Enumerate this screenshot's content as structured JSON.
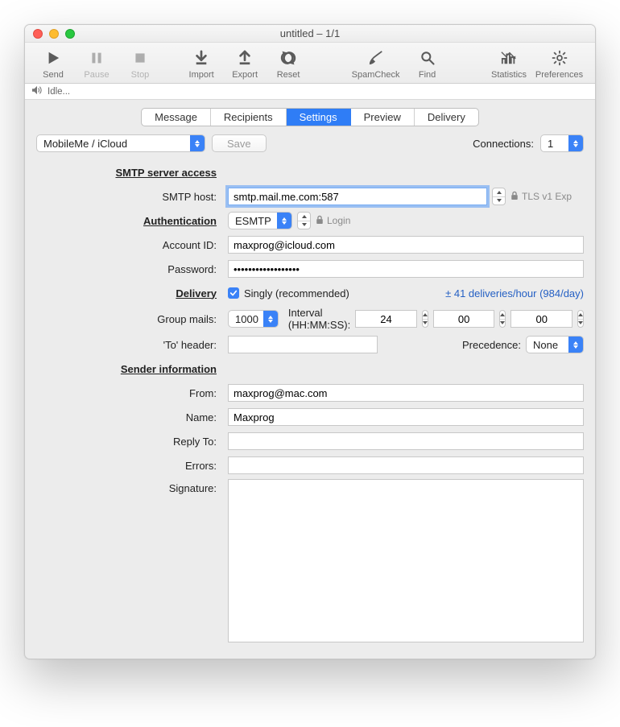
{
  "window": {
    "title": "untitled – 1/1"
  },
  "toolbar": {
    "send": "Send",
    "pause": "Pause",
    "stop": "Stop",
    "import": "Import",
    "export": "Export",
    "reset": "Reset",
    "spamcheck": "SpamCheck",
    "find": "Find",
    "statistics": "Statistics",
    "prefs": "Preferences"
  },
  "status": {
    "text": "Idle..."
  },
  "tabs": {
    "message": "Message",
    "recipients": "Recipients",
    "settings": "Settings",
    "preview": "Preview",
    "delivery": "Delivery"
  },
  "account": {
    "selected": "MobileMe / iCloud",
    "save": "Save",
    "connections_label": "Connections:",
    "connections_value": "1"
  },
  "sections": {
    "smtp": "SMTP server access",
    "auth": "Authentication",
    "delivery": "Delivery",
    "sender": "Sender information"
  },
  "labels": {
    "smtp_host": "SMTP host:",
    "account_id": "Account ID:",
    "password": "Password:",
    "group_mails": "Group mails:",
    "to_header": "'To' header:",
    "from": "From:",
    "name": "Name:",
    "reply_to": "Reply To:",
    "errors": "Errors:",
    "signature": "Signature:",
    "interval": "Interval (HH:MM:SS):",
    "precedence": "Precedence:",
    "tls": "TLS v1 Exp",
    "login": "Login",
    "singly": "Singly (recommended)",
    "rate": "± 41 deliveries/hour (984/day)"
  },
  "values": {
    "smtp_host": "smtp.mail.me.com:587",
    "auth_mode": "ESMTP",
    "account_id": "maxprog@icloud.com",
    "password": "••••••••••••••••••",
    "group_mails": "1000",
    "to_header": "",
    "from": "maxprog@mac.com",
    "name": "Maxprog",
    "reply_to": "",
    "errors": "",
    "signature": "",
    "precedence": "None",
    "hh": "24",
    "mm": "00",
    "ss": "00"
  }
}
